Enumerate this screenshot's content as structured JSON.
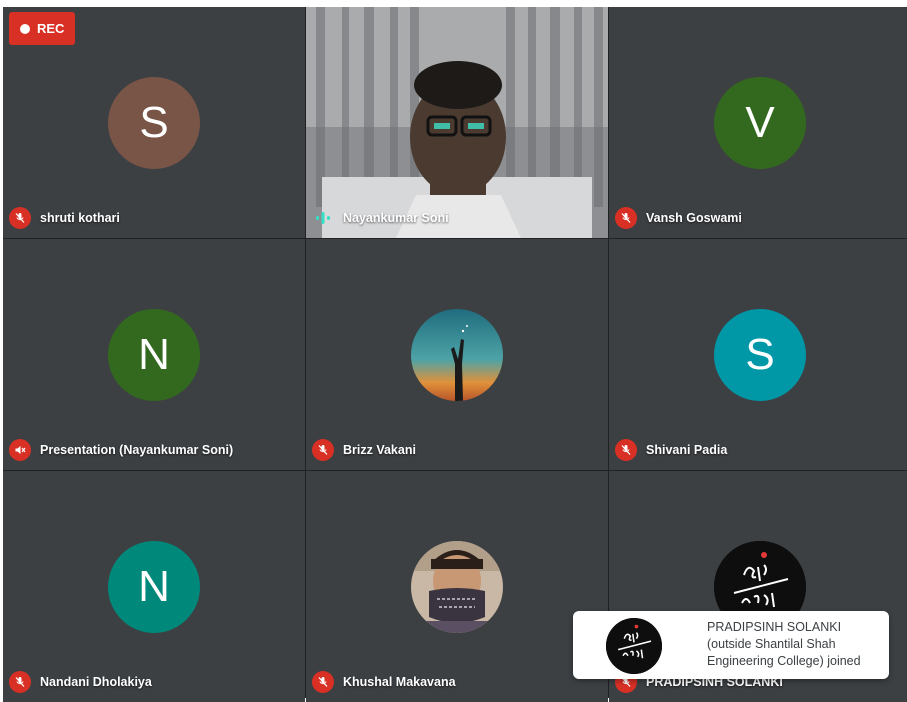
{
  "recording": {
    "label": "REC"
  },
  "participants": [
    {
      "name": "shruti kothari",
      "initial": "S",
      "avatar_color": "#795548",
      "mic": "muted"
    },
    {
      "name": "Nayankumar Soni",
      "type": "video",
      "mic": "speaking"
    },
    {
      "name": "Vansh Goswami",
      "initial": "V",
      "avatar_color": "#33691e",
      "mic": "muted"
    },
    {
      "name": "Presentation (Nayankumar Soni)",
      "initial": "N",
      "avatar_color": "#33691e",
      "mic": "muted"
    },
    {
      "name": "Brizz Vakani",
      "type": "photo",
      "mic": "muted"
    },
    {
      "name": "Shivani Padia",
      "initial": "S",
      "avatar_color": "#0097a7",
      "mic": "muted"
    },
    {
      "name": "Nandani Dholakiya",
      "initial": "N",
      "avatar_color": "#00897b",
      "mic": "muted"
    },
    {
      "name": "Khushal Makavana",
      "type": "photo",
      "mic": "muted"
    },
    {
      "name": "PRADIPSINH SOLANKI",
      "type": "logo",
      "mic": "muted"
    }
  ],
  "notification": {
    "line1": "PRADIPSINH SOLANKI",
    "line2": "(outside Shantilal Shah",
    "line3": "Engineering College) joined"
  },
  "colors": {
    "stage": "#202124",
    "muted_mic": "#d93025",
    "speaking": "#33e0c5",
    "rec": "#d93025"
  }
}
